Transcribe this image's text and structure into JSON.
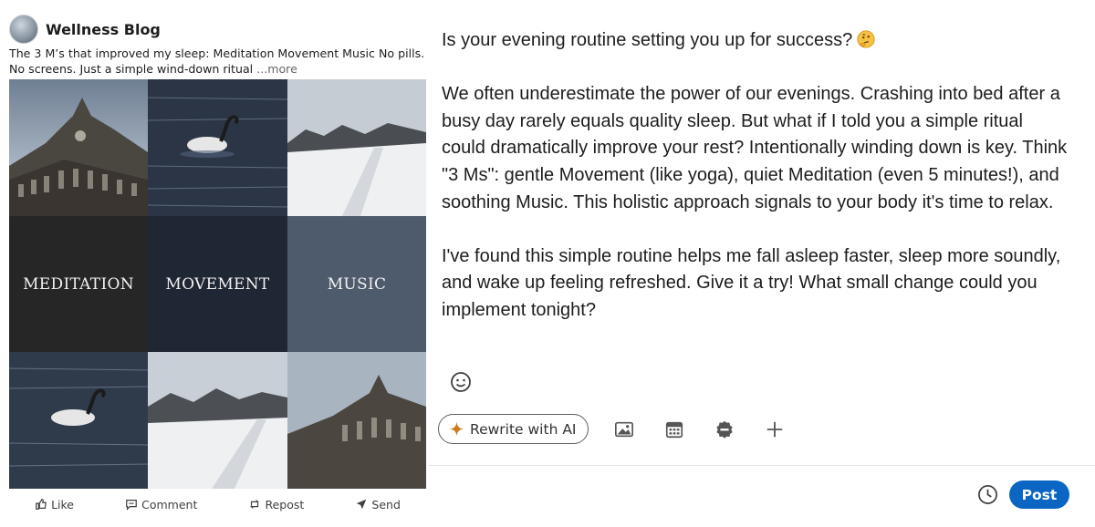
{
  "preview": {
    "author_name": "Wellness Blog",
    "caption": "The 3 M’s that improved my sleep: Meditation Movement Music No pills. No screens. Just a simple wind-down ritual",
    "more_label": "...more",
    "grid_words": [
      "MEDITATION",
      "MOVEMENT",
      "MUSIC"
    ],
    "actions": {
      "like": "Like",
      "comment": "Comment",
      "repost": "Repost",
      "send": "Send"
    }
  },
  "editor": {
    "paragraphs": [
      "Is your evening routine setting you up for success?",
      "We often underestimate the power of our evenings. Crashing into bed after a busy day rarely equals quality sleep. But what if I told you a simple ritual could dramatically improve your rest? Intentionally winding down is key. Think \"3 Ms\": gentle Movement (like yoga), quiet Meditation (even 5 minutes!), and soothing Music. This holistic approach signals to your body it's time to relax.",
      "I've found this simple routine helps me fall asleep faster, sleep more soundly, and wake up feeling refreshed. Give it a try! What small change could you implement tonight?"
    ],
    "title_emoji": "thinking-face-emoji"
  },
  "toolbar": {
    "rewrite_label": "Rewrite with AI",
    "icons": [
      "emoji-icon",
      "image-icon",
      "calendar-icon",
      "badge-icon",
      "plus-icon"
    ]
  },
  "footer": {
    "post_label": "Post",
    "clock_icon": "clock-icon"
  },
  "colors": {
    "accent": "#0a66c2",
    "ai_sparkle": "#c97c1f",
    "tile_dark": "#262626",
    "tile_navy": "#1f2634",
    "tile_slate": "#4e5b6c"
  }
}
